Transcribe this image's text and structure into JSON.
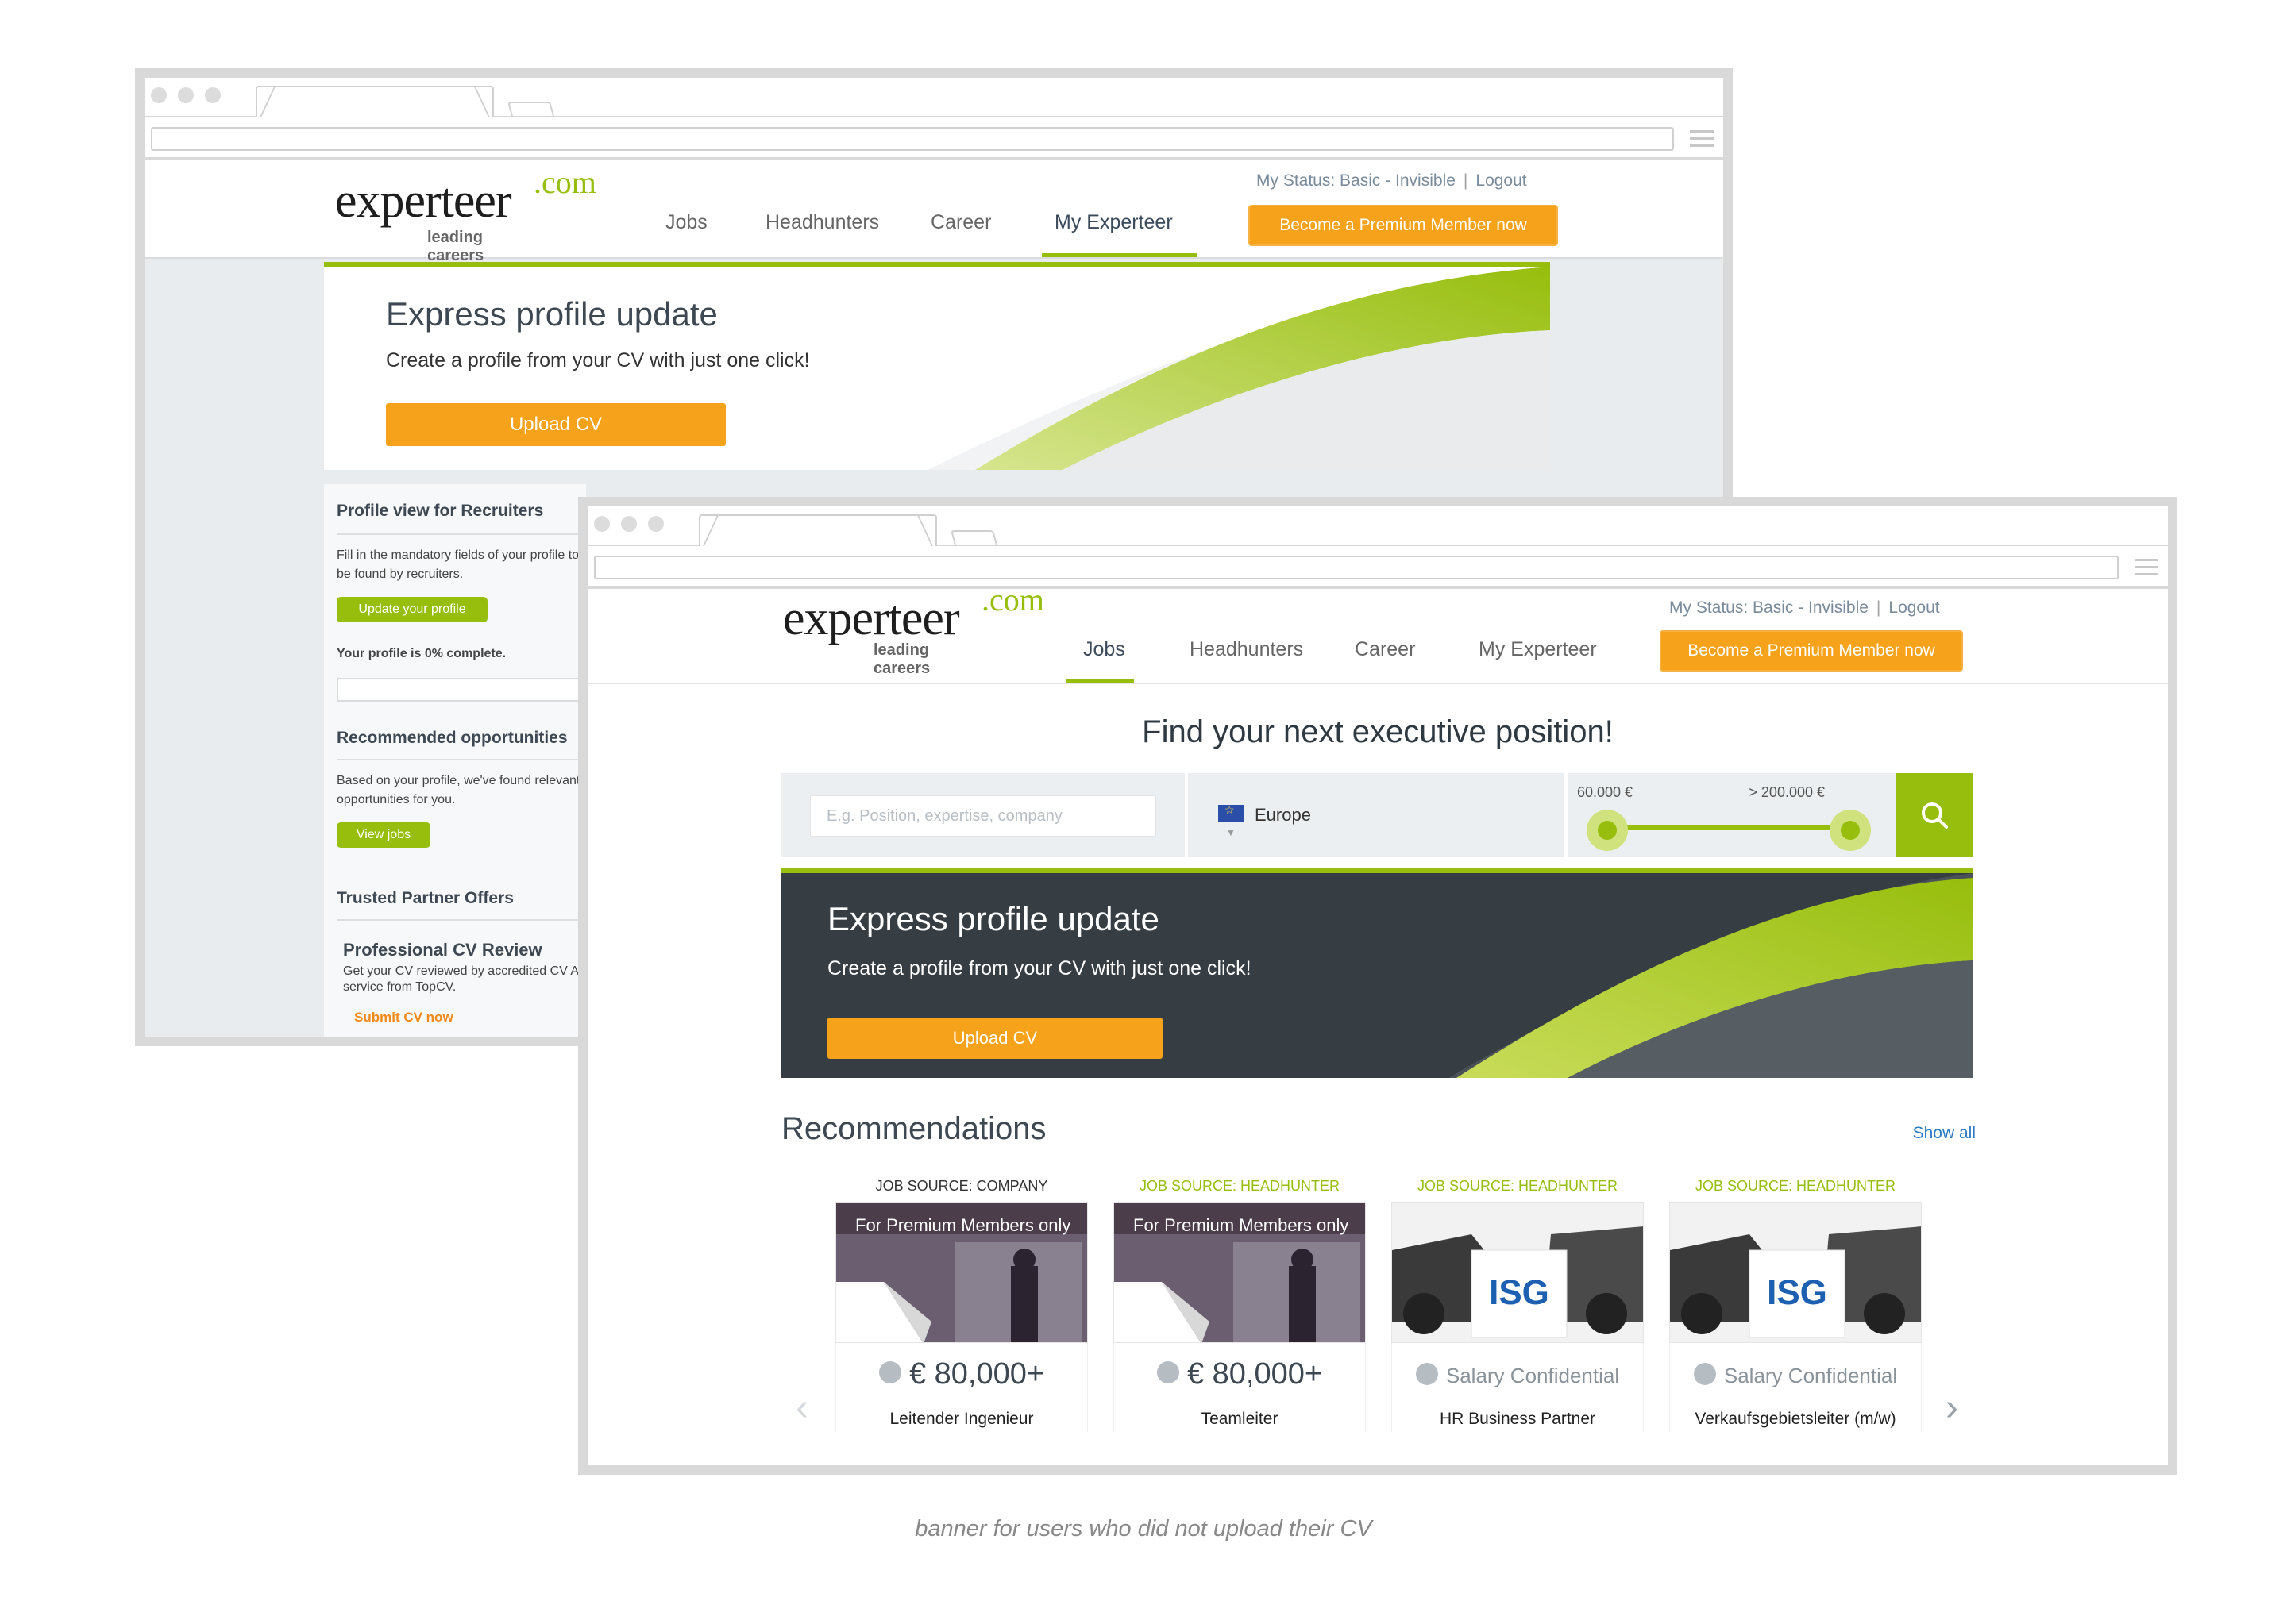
{
  "back_window": {
    "header": {
      "logo_word": "experteer",
      "logo_com": ".com",
      "logo_tagline": "leading careers",
      "nav": [
        "Jobs",
        "Headhunters",
        "Career",
        "My Experteer"
      ],
      "status": "My Status: Basic - Invisible",
      "logout": "Logout",
      "premium_button": "Become a Premium Member now"
    },
    "banner": {
      "title": "Express profile update",
      "subtitle": "Create a profile from your CV with just one click!",
      "button": "Upload CV"
    },
    "sidebar": {
      "profile_title": "Profile view for Recruiters",
      "profile_text": "Fill in the mandatory fields of your profile to be found by recruiters.",
      "update_button": "Update your profile",
      "complete_text": "Your profile is 0% complete.",
      "profile_complete": 0,
      "rec_title": "Recommended opportunities",
      "rec_text": "Based on your profile, we've found relevant opportunities for you.",
      "view_jobs": "View jobs",
      "partner_title": "Trusted Partner Offers",
      "cv_review_title": "Professional CV Review",
      "cv_review_text": "Get your CV reviewed by accredited CV A service from TopCV.",
      "submit_link": "Submit CV now"
    }
  },
  "front_window": {
    "header": {
      "logo_word": "experteer",
      "logo_com": ".com",
      "logo_tagline": "leading careers",
      "nav": [
        "Jobs",
        "Headhunters",
        "Career",
        "My Experteer"
      ],
      "status": "My Status: Basic - Invisible",
      "logout": "Logout",
      "premium_button": "Become a Premium Member now"
    },
    "hero_title": "Find your next executive position!",
    "search": {
      "placeholder": "E.g. Position, expertise, company",
      "region": "Europe",
      "salary_min": "60.000 €",
      "salary_max": "> 200.000 €"
    },
    "banner": {
      "title": "Express profile update",
      "subtitle": "Create a profile from your CV with just one click!",
      "button": "Upload CV"
    },
    "recommendations": {
      "title": "Recommendations",
      "show_all": "Show all",
      "cards": [
        {
          "source": "JOB SOURCE: COMPANY",
          "label": "For Premium Members only",
          "salary": "€ 80,000+",
          "title": "Leitender Ingenieur"
        },
        {
          "source": "JOB SOURCE: HEADHUNTER",
          "label": "For Premium Members only",
          "salary": "€ 80,000+",
          "title": "Teamleiter"
        },
        {
          "source": "JOB SOURCE: HEADHUNTER",
          "logo": "ISG",
          "salary": "Salary Confidential",
          "title": "HR Business Partner"
        },
        {
          "source": "JOB SOURCE: HEADHUNTER",
          "logo": "ISG",
          "salary": "Salary Confidential",
          "title": "Verkaufsgebietsleiter (m/w)"
        }
      ]
    }
  },
  "caption": "banner for users who did not upload their CV",
  "colors": {
    "accent_green": "#97be0d",
    "orange": "#f7a21b",
    "dark_banner": "#363d43",
    "link_blue": "#2e7bc4"
  }
}
